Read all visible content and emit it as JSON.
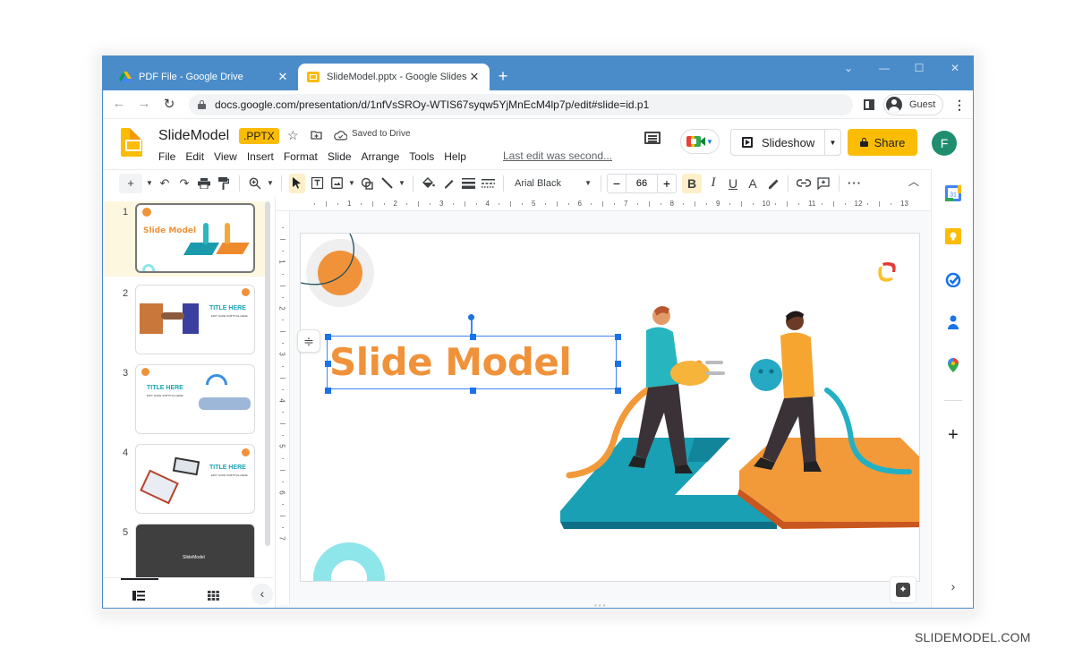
{
  "browser": {
    "tabs": [
      {
        "title": "PDF File - Google Drive",
        "icon": "google-drive-icon",
        "active": false
      },
      {
        "title": "SlideModel.pptx - Google Slides",
        "icon": "google-slides-icon",
        "active": true
      }
    ],
    "new_tab_label": "+",
    "url": "docs.google.com/presentation/d/1nfVsSROy-WTIS67syqw5YjMnEcM4lp7p/edit#slide=id.p1",
    "profile_label": "Guest"
  },
  "doc": {
    "title": "SlideModel",
    "badge": ".PPTX",
    "save_status": "Saved to Drive",
    "menu": [
      "File",
      "Edit",
      "View",
      "Insert",
      "Format",
      "Slide",
      "Arrange",
      "Tools",
      "Help"
    ],
    "last_edit": "Last edit was second...",
    "slideshow_label": "Slideshow",
    "share_label": "Share",
    "avatar_initial": "F",
    "avatar_color": "#1e8e6e",
    "accent_color": "#fbbc04"
  },
  "toolbar": {
    "font": "Arial Black",
    "font_size": "66",
    "bold_active": true
  },
  "ruler": {
    "horizontal": [
      "1",
      "2",
      "3",
      "4",
      "5",
      "6",
      "7",
      "8",
      "9",
      "10",
      "11",
      "12",
      "13"
    ],
    "vertical": [
      "1",
      "2",
      "3",
      "4",
      "5",
      "6",
      "7"
    ]
  },
  "slides": [
    {
      "number": "1",
      "title": "Slide Model",
      "selected": true
    },
    {
      "number": "2",
      "title": "TITLE HERE",
      "subtitle": "EDIT SLIDE SUBTITLE HERE"
    },
    {
      "number": "3",
      "title": "TITLE HERE",
      "subtitle": "EDIT SLIDE SUBTITLE HERE"
    },
    {
      "number": "4",
      "title": "TITLE HERE",
      "subtitle": "EDIT SLIDE SUBTITLE HERE"
    },
    {
      "number": "5",
      "title": "SlideModel"
    }
  ],
  "canvas": {
    "title_text": "Slide Model",
    "title_color": "#f0923a"
  },
  "watermark": "SLIDEMODEL.COM"
}
